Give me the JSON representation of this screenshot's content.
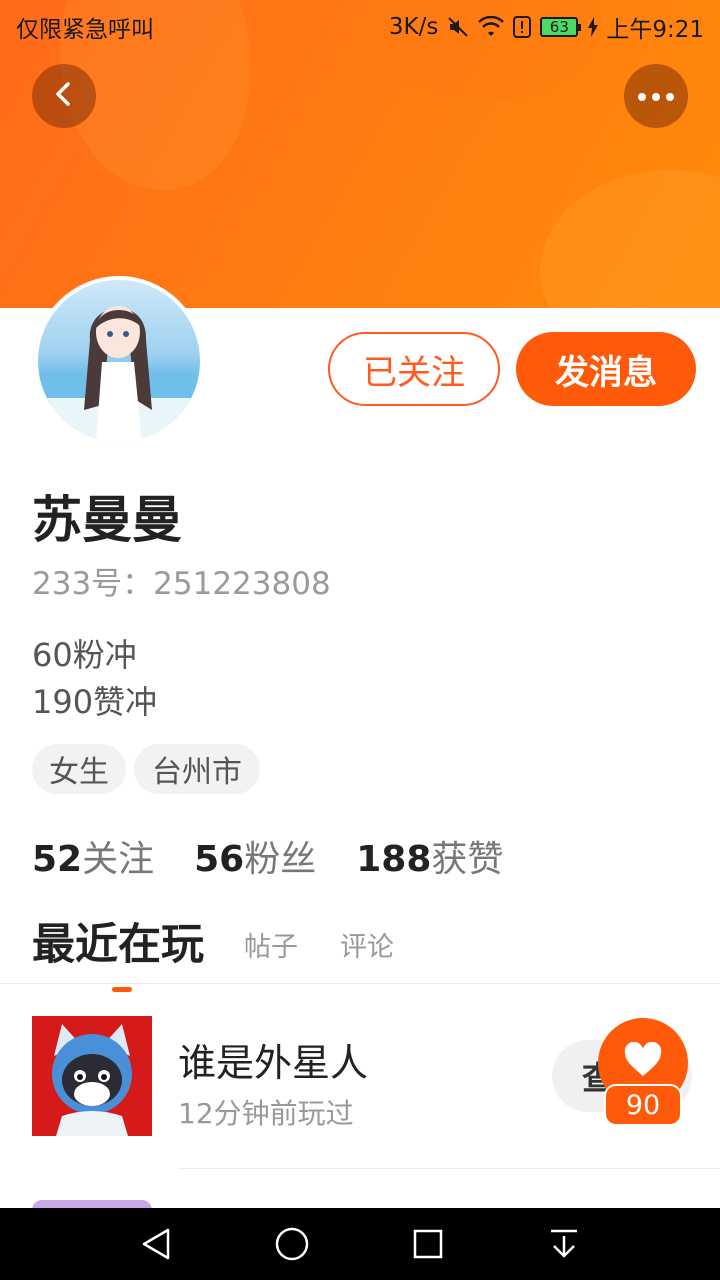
{
  "status_bar": {
    "carrier_text": "仅限紧急呼叫",
    "speed": "3K/s",
    "battery_level": "63",
    "time": "上午9:21",
    "icons": [
      "mute-icon",
      "wifi-icon",
      "alert-icon",
      "battery-icon",
      "charging-icon"
    ]
  },
  "header": {
    "back_icon": "chevron-left-icon",
    "more_icon": "more-dots-icon",
    "accent_color": "#ff6a1a"
  },
  "profile": {
    "name": "苏曼曼",
    "id_line": "233号：251223808",
    "bio": [
      "60粉冲",
      "190赞冲"
    ],
    "tags": [
      "女生",
      "台州市"
    ],
    "follow_label": "已关注",
    "message_label": "发消息"
  },
  "stats": [
    {
      "value": "52",
      "label": "关注"
    },
    {
      "value": "56",
      "label": "粉丝"
    },
    {
      "value": "188",
      "label": "获赞"
    }
  ],
  "tabs": {
    "active": "最近在玩",
    "others": [
      "帖子",
      "评论"
    ]
  },
  "recent_games": [
    {
      "title": "谁是外星人",
      "played": "12分钟前玩过",
      "action_label": "查"
    }
  ],
  "like_fab": {
    "count": "90"
  }
}
